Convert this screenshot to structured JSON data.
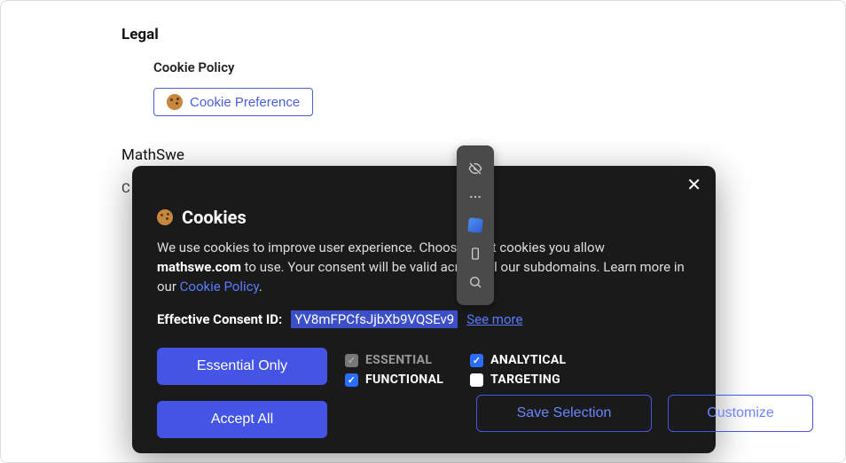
{
  "page": {
    "legal_heading": "Legal",
    "cookie_policy_heading": "Cookie Policy",
    "cookie_pref_btn": "Cookie Preference",
    "mathswe_heading": "MathSwe",
    "body_fragment": "C"
  },
  "dialog": {
    "title": "Cookies",
    "desc_prefix": "We use cookies to improve user experience. Choose what cookies you allow ",
    "domain": "mathswe.com",
    "desc_suffix": " to use. Your consent will be valid across all our subdomains. Learn more in our ",
    "cookie_policy_link": "Cookie Policy",
    "period": ".",
    "consent_label": "Effective Consent ID:",
    "consent_id": "YV8mFPCfsJjbXb9VQSEv9",
    "see_more": "See more",
    "buttons": {
      "essential_only": "Essential Only",
      "accept_all": "Accept All",
      "save_selection": "Save Selection",
      "customize": "Customize"
    },
    "checkboxes": {
      "essential": "ESSENTIAL",
      "analytical": "ANALYTICAL",
      "functional": "FUNCTIONAL",
      "targeting": "TARGETING"
    },
    "close": "✕"
  }
}
